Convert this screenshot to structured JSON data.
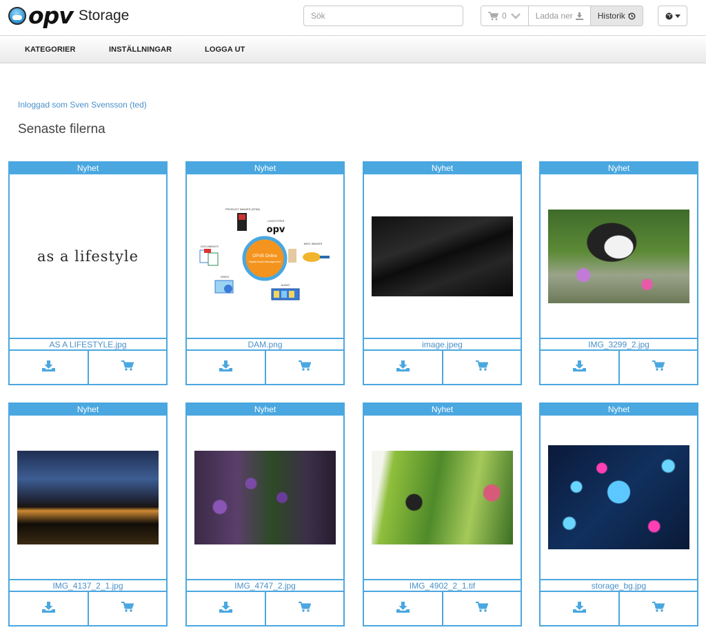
{
  "header": {
    "brand": "opv",
    "product": "Storage",
    "search_placeholder": "Sök",
    "cart_count": "0",
    "download_label": "Ladda ner",
    "history_label": "Historik"
  },
  "icons": {
    "logo": "cloud-logo-icon",
    "cart": "shopping-cart-icon",
    "chevron": "chevron-down-icon",
    "download": "download-icon",
    "history": "history-icon",
    "globe": "globe-icon",
    "card_download": "download-tray-icon",
    "card_cart": "add-to-cart-icon"
  },
  "nav": {
    "items": [
      {
        "label": "KATEGORIER"
      },
      {
        "label": "INSTÄLLNINGAR"
      },
      {
        "label": "LOGGA UT"
      }
    ]
  },
  "main": {
    "logged_in_text": "Inloggad som Sven Svensson (ted)",
    "section_title": "Senaste filerna"
  },
  "files": [
    {
      "badge": "Nyhet",
      "name": "AS A LIFESTYLE.jpg",
      "thumb_text": "as a lifestyle"
    },
    {
      "badge": "Nyhet",
      "name": "DAM.png",
      "thumb_labels": [
        "PRODUCT IMAGES (STIM)",
        "LOGOTYPES",
        "DOCUMENTS",
        "MISC IMAGES",
        "VIDEO",
        "AUDIO",
        "OPVB Online",
        "Digital Asset Management"
      ]
    },
    {
      "badge": "Nyhet",
      "name": "image.jpeg"
    },
    {
      "badge": "Nyhet",
      "name": "IMG_3299_2.jpg"
    },
    {
      "badge": "Nyhet",
      "name": "IMG_4137_2_1.jpg"
    },
    {
      "badge": "Nyhet",
      "name": "IMG_4747_2.jpg"
    },
    {
      "badge": "Nyhet",
      "name": "IMG_4902_2_1.tif"
    },
    {
      "badge": "Nyhet",
      "name": "storage_bg.jpg"
    }
  ],
  "colors": {
    "accent": "#4aa7e0",
    "link": "#4a90c8"
  }
}
